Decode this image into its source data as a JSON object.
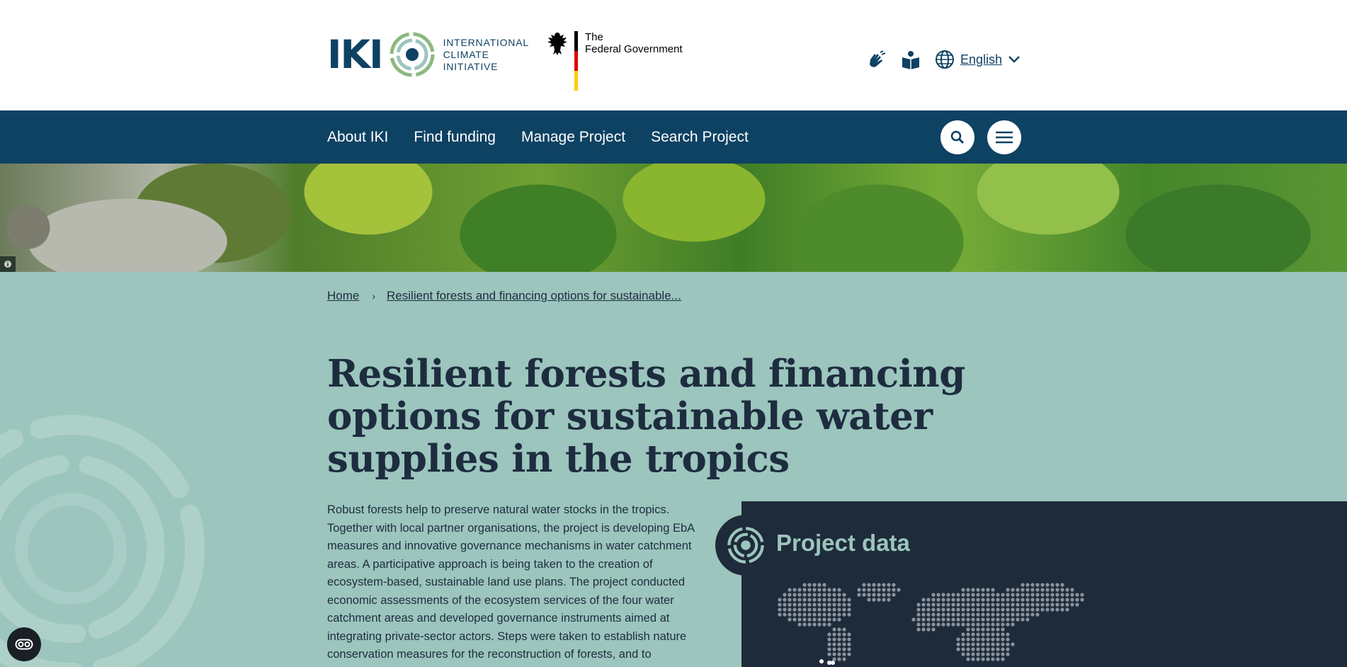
{
  "header": {
    "logo": {
      "letters": "IKI",
      "words": [
        "INTERNATIONAL",
        "CLIMATE",
        "INITIATIVE"
      ]
    },
    "government": {
      "line1": "The",
      "line2": "Federal Government",
      "flag_colors": [
        "#000000",
        "#dd0000",
        "#ffcc00"
      ]
    },
    "tools": {
      "sign_language_icon": "sign-language-icon",
      "easy_language_icon": "easy-language-icon",
      "language_icon": "globe-icon",
      "language_label": "English"
    }
  },
  "nav": {
    "links": [
      "About IKI",
      "Find funding",
      "Manage Project",
      "Search Project"
    ],
    "search_icon": "search-icon",
    "menu_icon": "menu-icon"
  },
  "breadcrumb": {
    "items": [
      "Home",
      "Resilient forests and financing options for sustainable..."
    ]
  },
  "page": {
    "title": "Resilient forests and financing options for sustainable water supplies in the tropics",
    "description": "Robust forests help to preserve natural water stocks in the tropics. Together with local partner organisations, the project is developing EbA measures and innovative governance mechanisms in water catchment areas. A participative approach is being taken to the creation of ecosystem-based, sustainable land use plans. The project conducted economic assessments of the ecosystem services of the four water catchment areas and developed governance instruments aimed at integrating private-sector actors. Steps were taken to establish nature conservation measures for the reconstruction of forests, and to"
  },
  "project_data": {
    "title": "Project data"
  },
  "colors": {
    "navy": "#0e4263",
    "mint": "#9cc5bd",
    "panel": "#1e2b3a",
    "logo_green": "#8db880"
  }
}
